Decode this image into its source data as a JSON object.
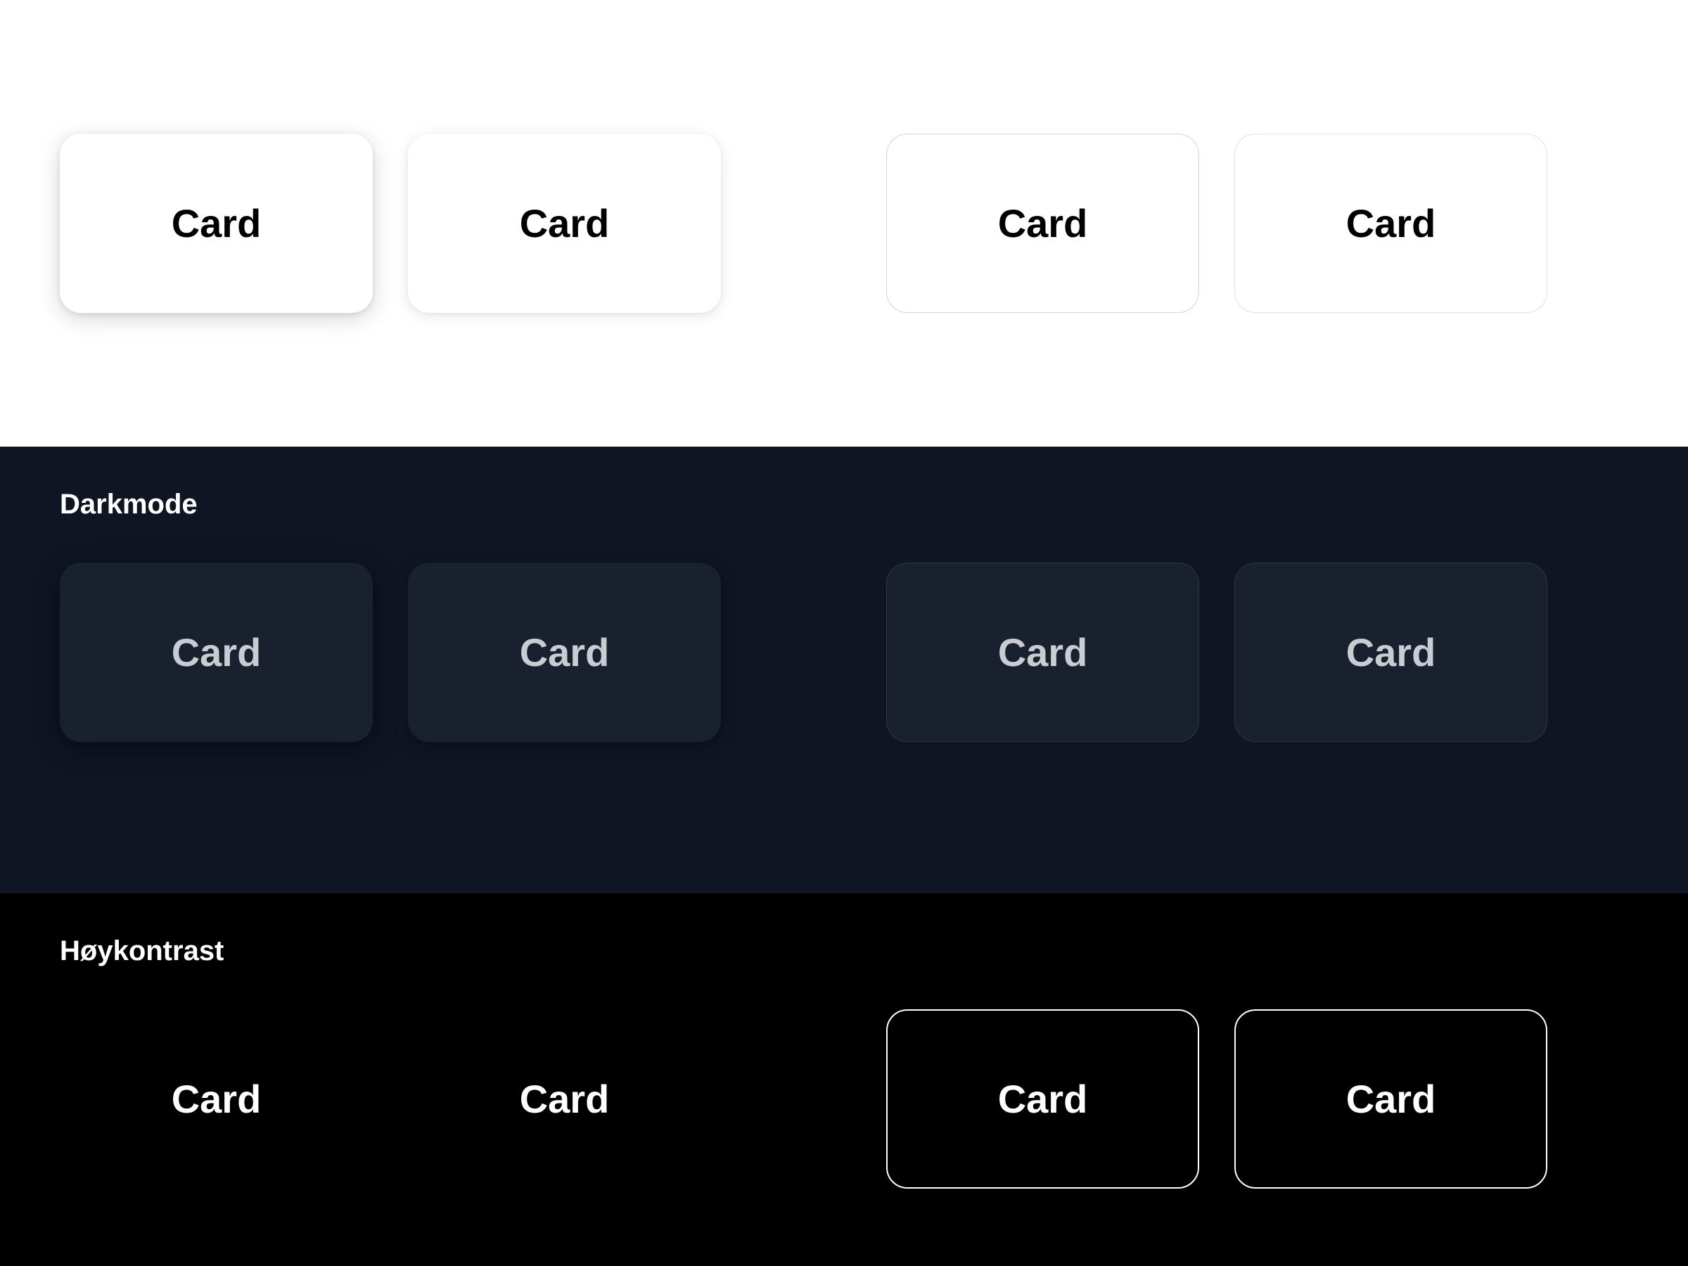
{
  "light": {
    "cards": [
      "Card",
      "Card",
      "Card",
      "Card"
    ]
  },
  "dark": {
    "title": "Darkmode",
    "cards": [
      "Card",
      "Card",
      "Card",
      "Card"
    ]
  },
  "highContrast": {
    "title": "Høykontrast",
    "cards": [
      "Card",
      "Card",
      "Card",
      "Card"
    ]
  }
}
